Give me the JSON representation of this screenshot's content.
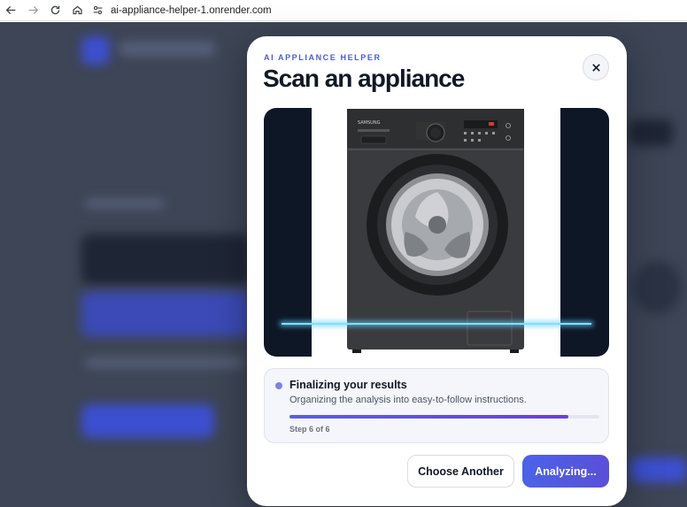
{
  "browser": {
    "url": "ai-appliance-helper-1.onrender.com"
  },
  "modal": {
    "eyebrow": "AI APPLIANCE HELPER",
    "title": "Scan an appliance",
    "image_alt": "Front-loading washing machine",
    "status": {
      "title": "Finalizing your results",
      "description": "Organizing the analysis into easy-to-follow instructions.",
      "progress": 0.9,
      "step_label": "Step 6 of 6"
    },
    "buttons": {
      "secondary": "Choose Another",
      "primary": "Analyzing..."
    }
  },
  "colors": {
    "accent": "#4a5bd6",
    "scan_background": "#0e1726",
    "scan_line": "#7fe0ff"
  }
}
